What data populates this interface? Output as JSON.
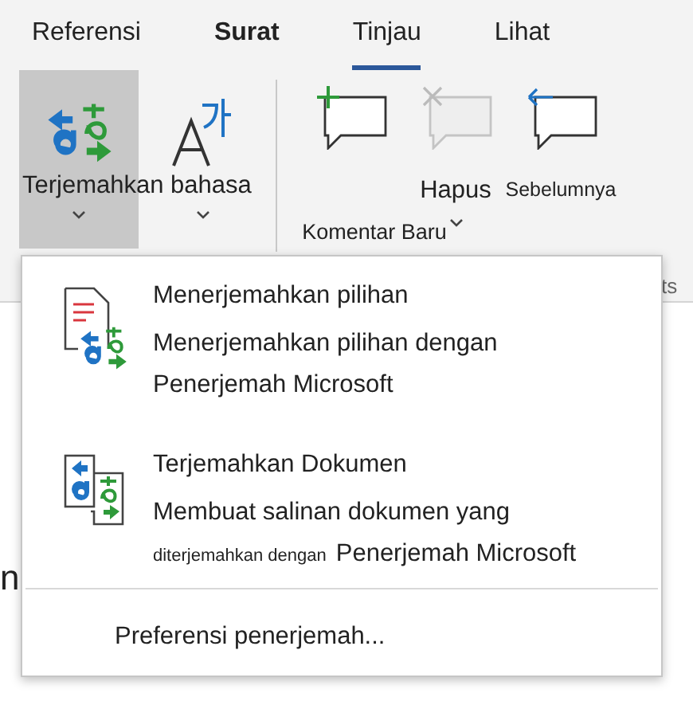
{
  "tabs": [
    {
      "label": "Referensi",
      "selected": false,
      "bold": false
    },
    {
      "label": "Surat",
      "selected": false,
      "bold": true
    },
    {
      "label": "Tinjau",
      "selected": true,
      "bold": false
    },
    {
      "label": "Lihat",
      "selected": false,
      "bold": false
    }
  ],
  "ribbon": {
    "translate_label": "Terjemahkan bahasa",
    "translate_pressed": true,
    "comment_buttons": [
      {
        "kind": "new",
        "label": "Komentar Baru",
        "disabled": false
      },
      {
        "kind": "delete",
        "label": "Hapus",
        "disabled": true
      },
      {
        "kind": "previous",
        "label": "Sebelumnya",
        "disabled": false
      }
    ],
    "group_label_fragment": "ts"
  },
  "document_text": "n",
  "menu": {
    "items": [
      {
        "kind": "selection",
        "title": "Menerjemahkan pilihan",
        "description": [
          {
            "text": "Menerjemahkan pilihan dengan",
            "small": false
          },
          {
            "text": "Penerjemah Microsoft",
            "small": false
          }
        ]
      },
      {
        "kind": "document",
        "title": "Terjemahkan Dokumen",
        "description": [
          {
            "text": "Membuat salinan dokumen yang",
            "small": false
          },
          {
            "text": "diterjemahkan dengan",
            "small": true
          },
          {
            "text": "Penerjemah Microsoft",
            "small": false
          }
        ]
      }
    ],
    "footer": "Preferensi penerjemah..."
  }
}
